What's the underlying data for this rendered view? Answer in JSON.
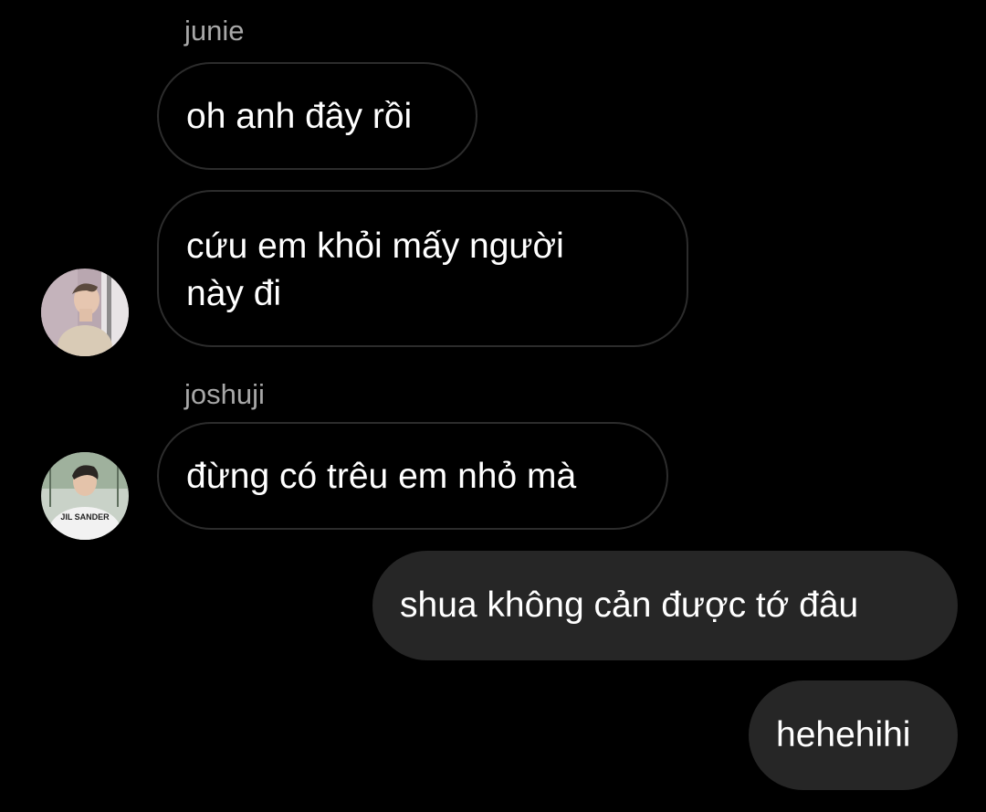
{
  "thread": {
    "messages": [
      {
        "sender": "junie",
        "text": "oh anh đây rồi",
        "direction": "incoming"
      },
      {
        "text_line1": "cứu em khỏi mấy người",
        "text_line2": "này đi",
        "direction": "incoming"
      },
      {
        "sender": "joshuji",
        "text": "đừng có trêu em nhỏ mà",
        "direction": "incoming"
      },
      {
        "text": "shua không cản được tớ đâu",
        "direction": "outgoing"
      },
      {
        "text": "hehehihi",
        "direction": "outgoing"
      }
    ],
    "avatar_shirt_text": "JIL SANDER"
  },
  "colors": {
    "background": "#000000",
    "incoming_border": "#2c2c2c",
    "outgoing_bubble": "#262626",
    "sender_name": "#a8a8a8",
    "text": "#ffffff"
  }
}
